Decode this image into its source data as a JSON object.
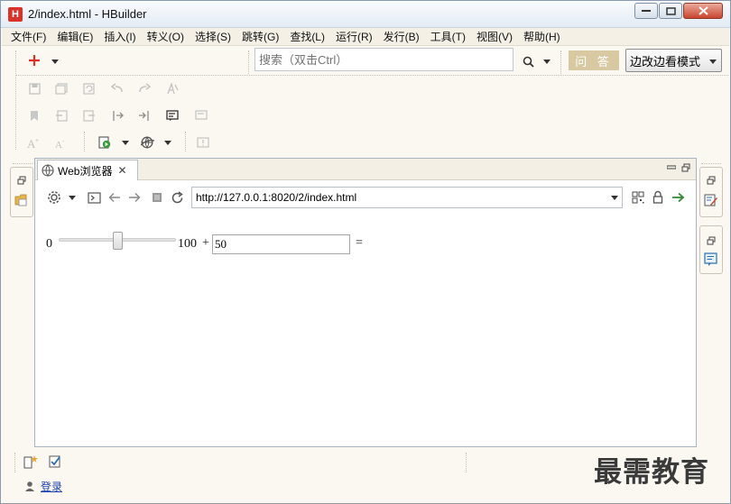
{
  "window": {
    "title": "2/index.html  -  HBuilder",
    "app_icon_letter": "H"
  },
  "menu": {
    "items": [
      "文件(F)",
      "编辑(E)",
      "插入(I)",
      "转义(O)",
      "选择(S)",
      "跳转(G)",
      "查找(L)",
      "运行(R)",
      "发行(B)",
      "工具(T)",
      "视图(V)",
      "帮助(H)"
    ]
  },
  "toolbar": {
    "search_placeholder": "搜索（双击Ctrl）",
    "qa_label": "问 答",
    "mode_label": "边改边看模式"
  },
  "editor": {
    "tab_label": "Web浏览器",
    "url": "http://127.0.0.1:8020/2/index.html"
  },
  "content": {
    "slider_min": "0",
    "slider_max": "100",
    "slider_value": 0.5,
    "plus_sign": "+",
    "input_value": "50",
    "equals_sign": "="
  },
  "bottom": {
    "login_label": "登录",
    "watermark": "最需教育"
  },
  "colors": {
    "accent_red": "#d8322a",
    "qa_button": "#d8c9a3",
    "panel_bg": "#fbf8f1",
    "go_arrow": "#2f8a2f"
  }
}
